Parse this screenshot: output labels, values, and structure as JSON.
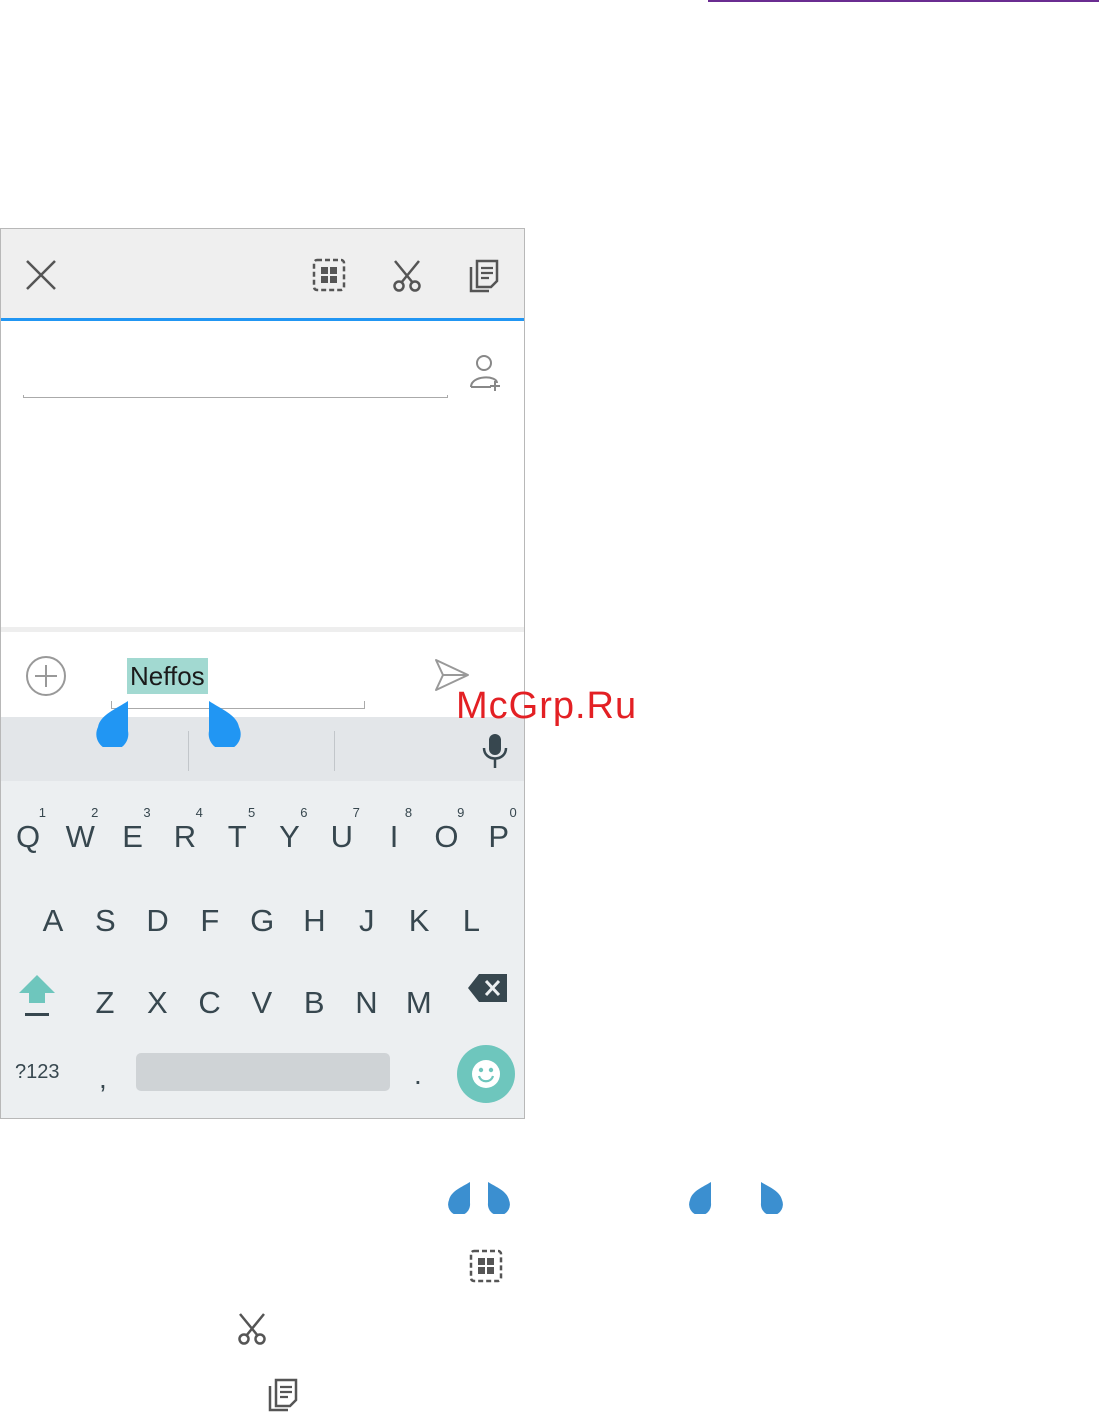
{
  "toolbar": {
    "close_icon": "close-icon",
    "select_all_icon": "select-all-icon",
    "cut_icon": "scissors-icon",
    "copy_icon": "copy-icon",
    "accent_color": "#2196f3"
  },
  "compose": {
    "recipient_value": "",
    "message_value": "Neffos",
    "selection_color": "#a2d9d1",
    "handle_color": "#2196f3"
  },
  "keyboard": {
    "row1": [
      {
        "key": "Q",
        "hint": "1"
      },
      {
        "key": "W",
        "hint": "2"
      },
      {
        "key": "E",
        "hint": "3"
      },
      {
        "key": "R",
        "hint": "4"
      },
      {
        "key": "T",
        "hint": "5"
      },
      {
        "key": "Y",
        "hint": "6"
      },
      {
        "key": "U",
        "hint": "7"
      },
      {
        "key": "I",
        "hint": "8"
      },
      {
        "key": "O",
        "hint": "9"
      },
      {
        "key": "P",
        "hint": "0"
      }
    ],
    "row2": [
      "A",
      "S",
      "D",
      "F",
      "G",
      "H",
      "J",
      "K",
      "L"
    ],
    "row3": [
      "Z",
      "X",
      "C",
      "V",
      "B",
      "N",
      "M"
    ],
    "symbols_label": "?123",
    "comma_label": ",",
    "period_label": ".",
    "accent_color": "#6ec6bd"
  },
  "watermark": "McGrp.Ru"
}
